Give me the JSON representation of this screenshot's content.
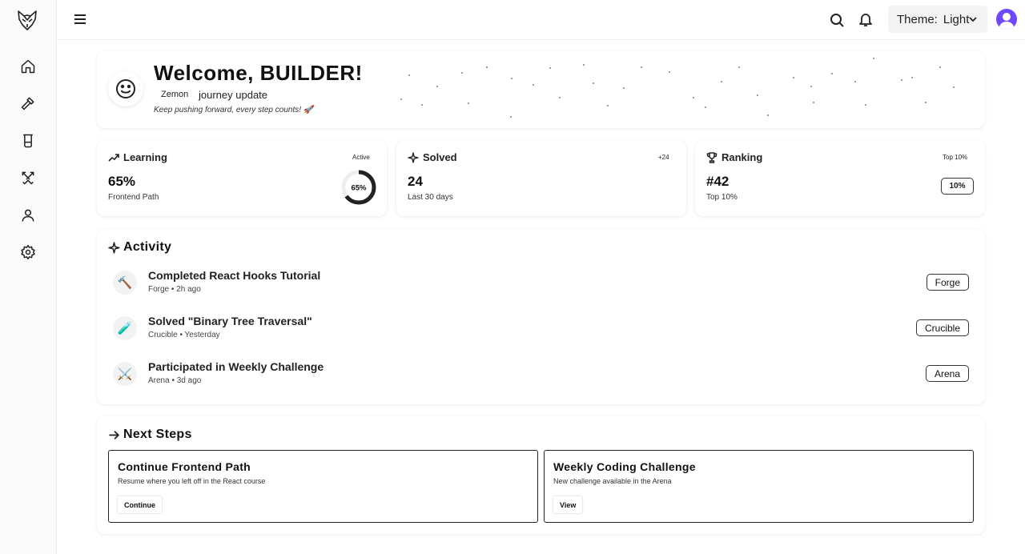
{
  "sidebar": {
    "logo": "fox-logo-icon",
    "items": [
      {
        "icon": "home-icon"
      },
      {
        "icon": "hammer-icon"
      },
      {
        "icon": "beaker-icon"
      },
      {
        "icon": "crossed-swords-icon"
      },
      {
        "icon": "user-icon"
      },
      {
        "icon": "gear-icon"
      }
    ]
  },
  "header": {
    "theme_label": "Theme:",
    "theme_value": "Light"
  },
  "welcome": {
    "title": "Welcome, BUILDER!",
    "badge": "Zemon",
    "journey": "journey update",
    "subtitle": "Keep pushing forward, every step counts! 🚀"
  },
  "stats": {
    "learning": {
      "title": "Learning",
      "tag": "Active",
      "value": "65%",
      "sub": "Frontend Path",
      "ring_label": "65%",
      "progress": 0.65
    },
    "solved": {
      "title": "Solved",
      "tag": "+24",
      "value": "24",
      "sub": "Last 30 days"
    },
    "ranking": {
      "title": "Ranking",
      "tag": "Top 10%",
      "value": "#42",
      "sub": "Top 10%",
      "pill": "10%"
    }
  },
  "activity": {
    "title": "Activity",
    "items": [
      {
        "icon": "🔨",
        "title": "Completed React Hooks Tutorial",
        "meta": "Forge • 2h ago",
        "tag": "Forge"
      },
      {
        "icon": "🧪",
        "title": "Solved \"Binary Tree Traversal\"",
        "meta": "Crucible • Yesterday",
        "tag": "Crucible"
      },
      {
        "icon": "⚔️",
        "title": "Participated in Weekly Challenge",
        "meta": "Arena • 3d ago",
        "tag": "Arena"
      }
    ]
  },
  "next_steps": {
    "title": "Next Steps",
    "items": [
      {
        "title": "Continue Frontend Path",
        "desc": "Resume where you left off in the React course",
        "button": "Continue"
      },
      {
        "title": "Weekly Coding Challenge",
        "desc": "New challenge available in the Arena",
        "button": "View"
      }
    ]
  }
}
